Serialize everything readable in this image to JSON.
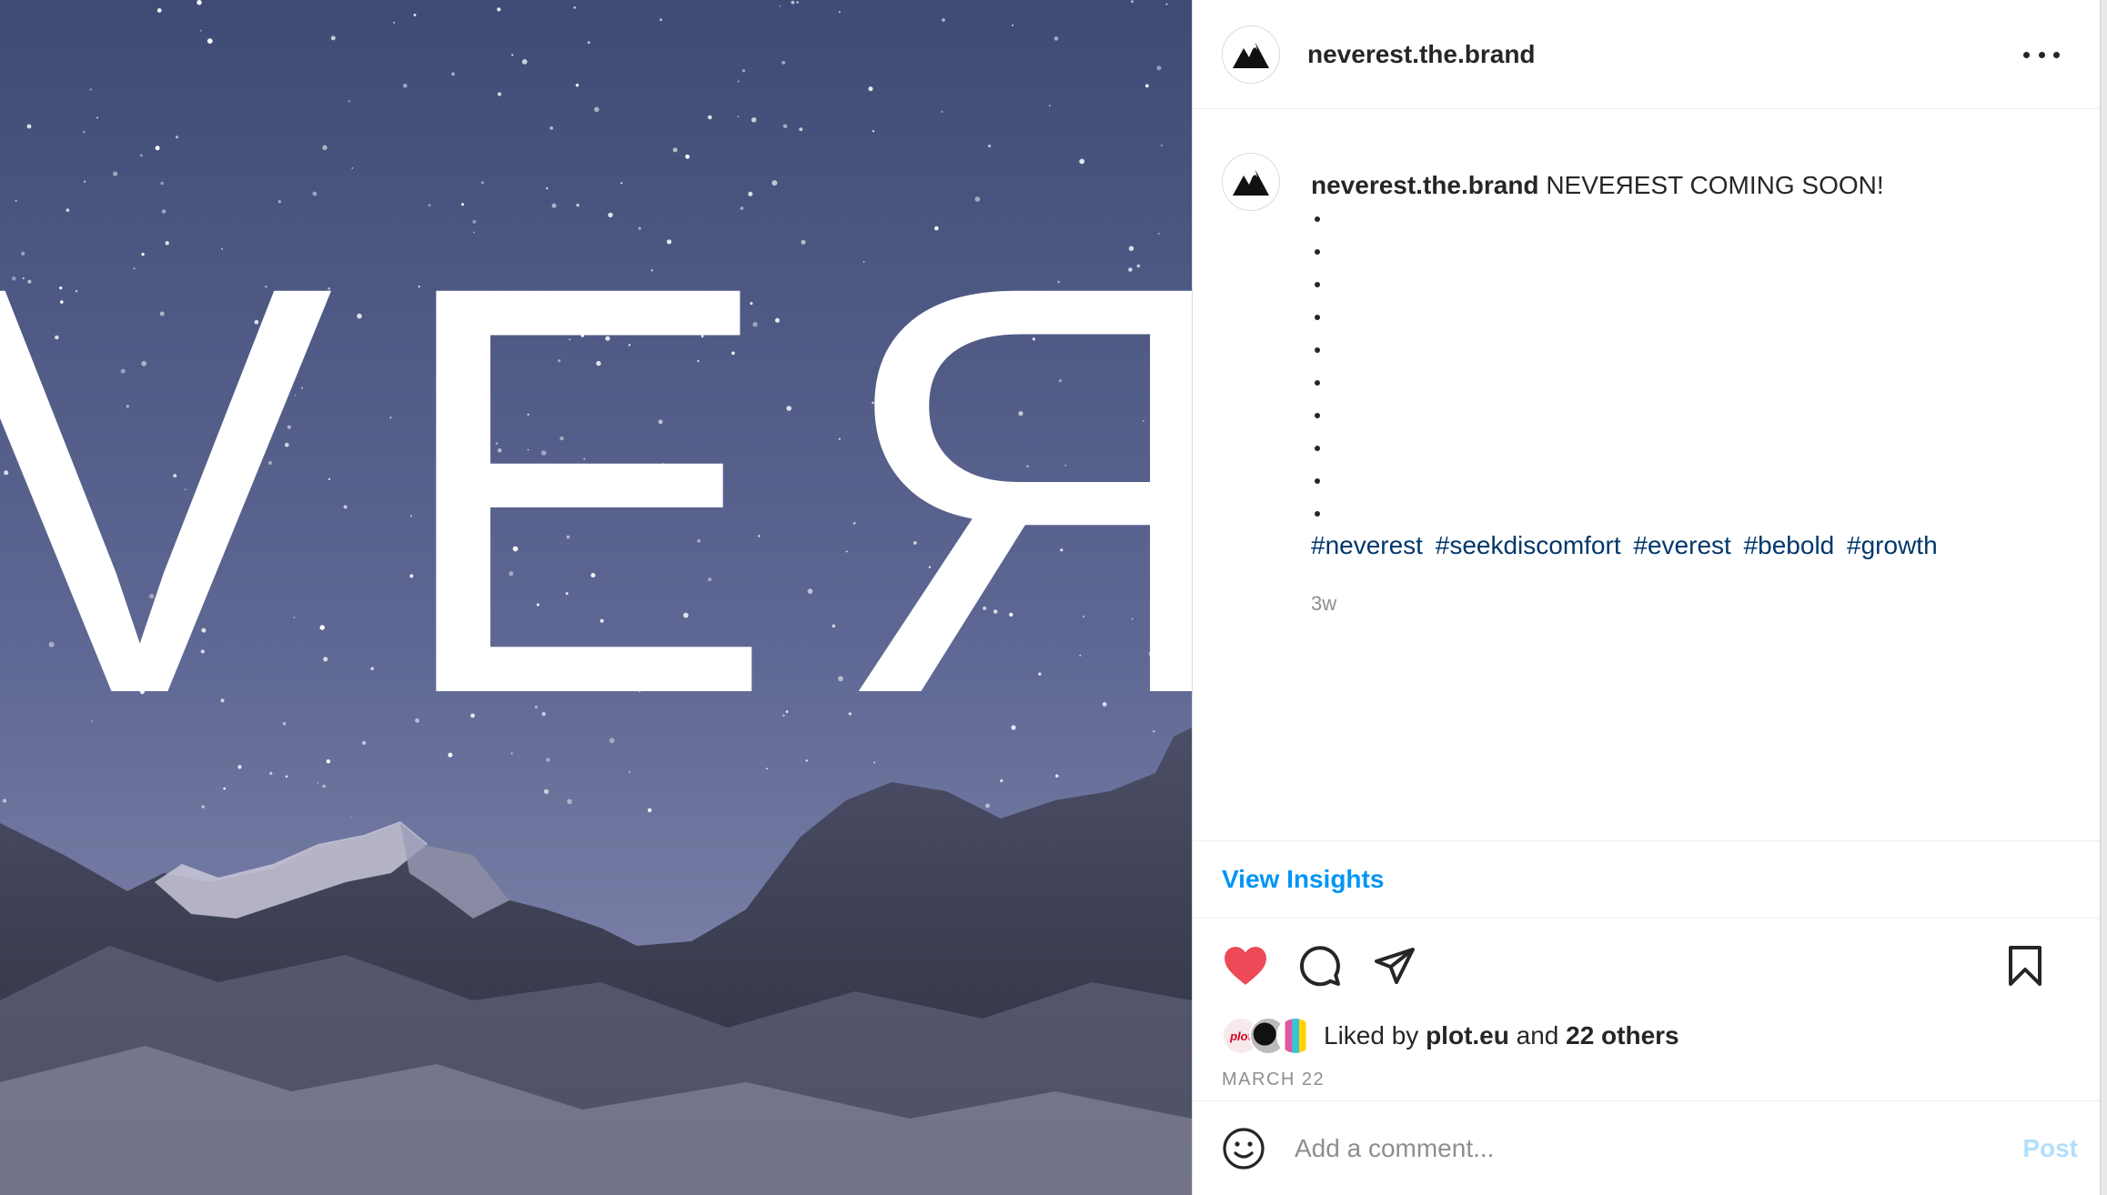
{
  "post": {
    "username": "neverest.the.brand",
    "image_text": "VEЯ",
    "caption": {
      "username": "neverest.the.brand",
      "text": "NEVEЯEST COMING SOON!",
      "bullets": [
        "",
        "",
        "",
        "",
        "",
        "",
        "",
        "",
        "",
        ""
      ],
      "hashtags": [
        "#neverest",
        "#seekdiscomfort",
        "#everest",
        "#bebold",
        "#growth"
      ],
      "time_ago": "3w"
    },
    "insights_label": "View Insights",
    "likes": {
      "prefix": "Liked by",
      "first_liker": "plot.eu",
      "joiner": "and",
      "others": "22 others",
      "avatar1_text": "plot"
    },
    "date": "MARCH 22",
    "comment": {
      "placeholder": "Add a comment...",
      "post_label": "Post"
    }
  },
  "colors": {
    "like": "#ed4956",
    "link": "#0095f6",
    "hashtag": "#00376b",
    "post_disabled": "#b2dffc"
  },
  "icons": {
    "more": "more-horizontal-icon",
    "like": "heart-filled-icon",
    "comment": "comment-bubble-icon",
    "share": "paper-plane-icon",
    "save": "bookmark-icon",
    "emoji": "emoji-smile-icon",
    "logo": "mountain-logo-icon"
  }
}
